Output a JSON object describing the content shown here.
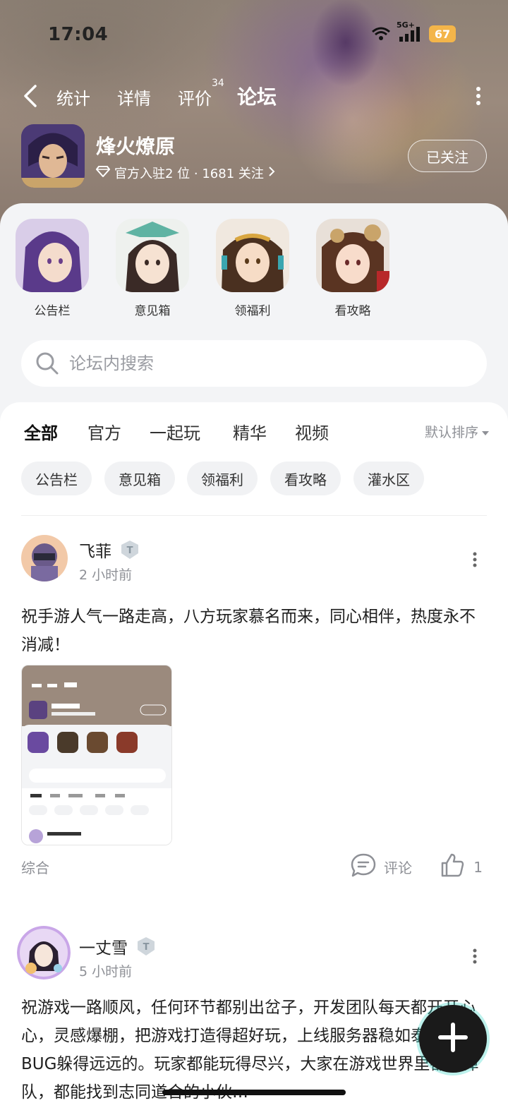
{
  "status_bar": {
    "time": "17:04",
    "network": "5G+",
    "battery": "67"
  },
  "nav": {
    "tabs": [
      {
        "label": "统计",
        "active": false
      },
      {
        "label": "详情",
        "active": false
      },
      {
        "label": "评价",
        "badge": "34",
        "active": false
      },
      {
        "label": "论坛",
        "active": true
      }
    ]
  },
  "game": {
    "name": "烽火燎原",
    "meta": "官方入驻2 位 · 1681 关注",
    "follow_label": "已关注"
  },
  "shortcuts": [
    {
      "label": "公告栏"
    },
    {
      "label": "意见箱"
    },
    {
      "label": "领福利"
    },
    {
      "label": "看攻略"
    }
  ],
  "search": {
    "placeholder": "论坛内搜索"
  },
  "filter_tabs": [
    {
      "label": "全部",
      "active": true
    },
    {
      "label": "官方"
    },
    {
      "label": "一起玩"
    },
    {
      "label": "精华"
    },
    {
      "label": "视频"
    }
  ],
  "sort_label": "默认排序",
  "chips": [
    "公告栏",
    "意见箱",
    "领福利",
    "看攻略",
    "灌水区"
  ],
  "posts": [
    {
      "author": "飞菲",
      "time": "2 小时前",
      "text": "祝手游人气一路走高，八方玩家慕名而来，同心相伴，热度永不消减！",
      "category": "综合",
      "comment_label": "评论",
      "likes": "1"
    },
    {
      "author": "一丈雪",
      "time": "5 小时前",
      "text": "祝游戏一路顺风，任何环节都别出岔子，开发团队每天都开开心心，灵感爆棚，把游戏打造得超好玩，上线服务器稳如泰山， BUG躲得远远的。玩家都能玩得尽兴，大家在游戏世界里都不掉队，都能找到志同道合的小伙…"
    }
  ],
  "colors": {
    "accent": "#3fd7c8",
    "panel_bg": "#f3f4f6",
    "battery": "#f3b54a"
  }
}
